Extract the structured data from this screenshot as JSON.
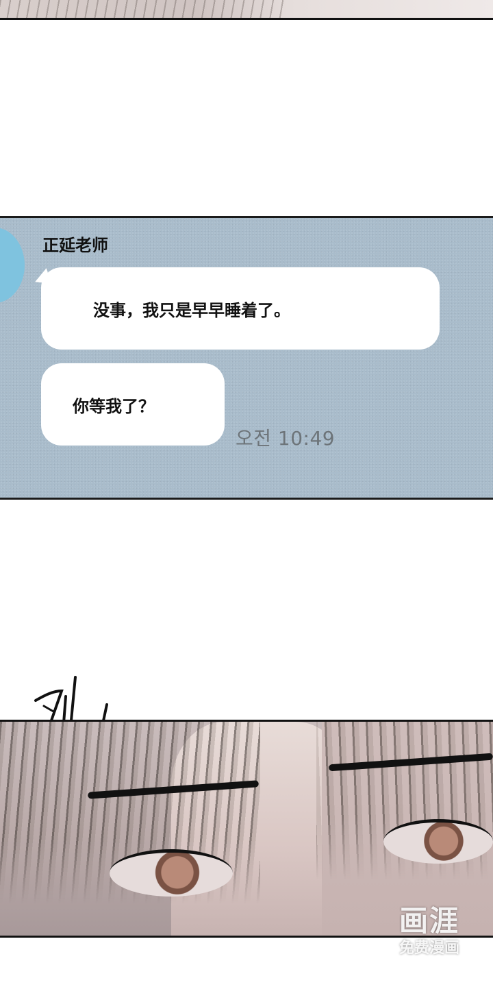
{
  "chat": {
    "sender_name": "正延老师",
    "messages": [
      {
        "text": "没事，我只是早早睡着了。"
      },
      {
        "text": "你等我了？"
      }
    ],
    "timestamp": "오전 10:49",
    "colors": {
      "background": "#a9bccb",
      "bubble": "#ffffff",
      "avatar": "#7fc3df",
      "timestamp": "#6d7479"
    }
  },
  "sound_effect": {
    "text": "찌잉"
  },
  "watermark": {
    "logo": "画涯",
    "subtitle": "免费漫画"
  }
}
